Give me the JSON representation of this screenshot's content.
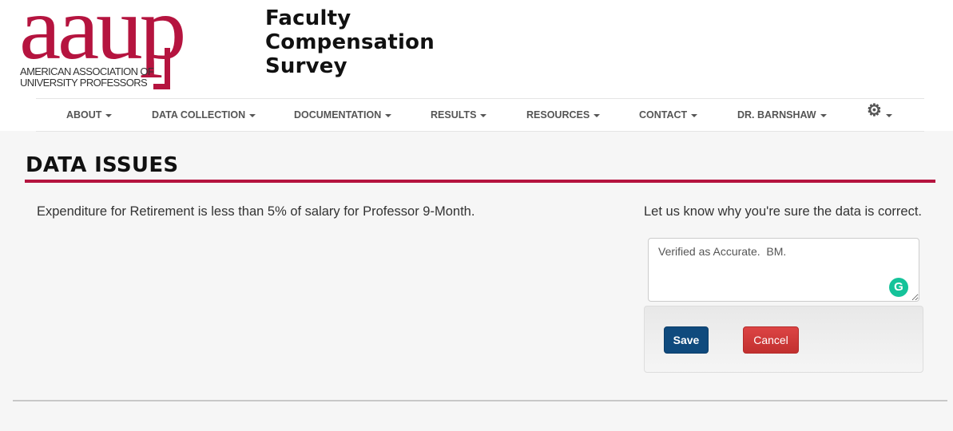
{
  "header": {
    "logo": {
      "wordmark": "aaup",
      "subtitle_line1": "AMERICAN ASSOCIATION OF",
      "subtitle_line2": "UNIVERSITY PROFESSORS",
      "brand_color": "#b5143f"
    },
    "site_title": [
      "Faculty",
      "Compensation",
      "Survey"
    ]
  },
  "nav": {
    "items": [
      {
        "label": "ABOUT"
      },
      {
        "label": "DATA COLLECTION"
      },
      {
        "label": "DOCUMENTATION"
      },
      {
        "label": "RESULTS"
      },
      {
        "label": "RESOURCES"
      },
      {
        "label": "CONTACT"
      },
      {
        "label": "DR. BARNSHAW"
      }
    ],
    "settings_icon": "gear-icon"
  },
  "main": {
    "heading": "DATA ISSUES",
    "issue_text": "Expenditure for Retirement is less than 5% of salary for Professor 9-Month.",
    "prompt_text": "Let us know why you're sure the data is correct.",
    "comment_value": "Verified as Accurate.  BM.",
    "grammarly_icon": "G",
    "save_label": "Save",
    "cancel_label": "Cancel"
  },
  "colors": {
    "accent": "#b5143f",
    "save_button": "#0f4a7d",
    "cancel_button": "#d03b3b",
    "background": "#f6f6f6"
  }
}
